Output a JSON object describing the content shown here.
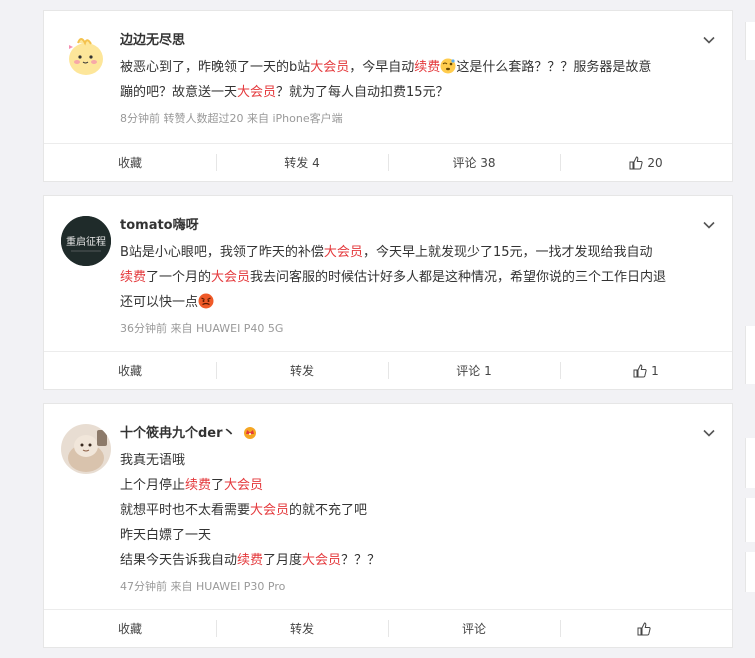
{
  "posts": [
    {
      "username": "边边无尽思",
      "lines": [
        [
          {
            "t": "被恶心到了，昨晚领了一天的b站"
          },
          {
            "t": "大会员",
            "hl": true
          },
          {
            "t": "，今早自动"
          },
          {
            "t": "续费",
            "hl": true
          },
          {
            "emoji": "dizzy-face"
          },
          {
            "t": "这是什么套路？？？服务器是故意"
          }
        ],
        [
          {
            "t": "蹦的吧？故意送一天"
          },
          {
            "t": "大会员",
            "hl": true
          },
          {
            "t": "？就为了每人自动扣费15元？"
          }
        ]
      ],
      "meta": "8分钟前  转赞人数超过20  来自 iPhone客户端",
      "actions": [
        "收藏",
        "转发 4",
        "评论 38",
        "20"
      ]
    },
    {
      "username": "tomato嗨呀",
      "lines": [
        [
          {
            "t": "B站是小心眼吧，我领了昨天的补偿"
          },
          {
            "t": "大会员",
            "hl": true
          },
          {
            "t": "，今天早上就发现少了15元，一找才发现给我自动"
          }
        ],
        [
          {
            "t": "续费",
            "hl": true
          },
          {
            "t": "了一个月的"
          },
          {
            "t": "大会员",
            "hl": true
          },
          {
            "t": "我去问客服的时候估计好多人都是这种情况，希望你说的三个工作日内退"
          }
        ],
        [
          {
            "t": "还可以快一点"
          },
          {
            "emoji": "angry-face"
          }
        ]
      ],
      "meta": "36分钟前  来自 HUAWEI P40 5G",
      "actions": [
        "收藏",
        "转发",
        "评论 1",
        "1"
      ],
      "avatar_text": "重启征程"
    },
    {
      "username": "十个筱冉九个der丶",
      "lines": [
        [
          {
            "t": "我真无语哦"
          }
        ],
        [
          {
            "t": "上个月停止"
          },
          {
            "t": "续费",
            "hl": true
          },
          {
            "t": "了"
          },
          {
            "t": "大会员",
            "hl": true
          }
        ],
        [
          {
            "t": "就想平时也不太看需要"
          },
          {
            "t": "大会员",
            "hl": true
          },
          {
            "t": "的就不充了吧"
          }
        ],
        [
          {
            "t": "昨天白嫖了一天"
          }
        ],
        [
          {
            "t": "结果今天告诉我自动"
          },
          {
            "t": "续费",
            "hl": true
          },
          {
            "t": "了月度"
          },
          {
            "t": "大会员",
            "hl": true
          },
          {
            "t": "？？？"
          }
        ]
      ],
      "meta": "47分钟前  来自 HUAWEI P30 Pro",
      "actions": [
        "收藏",
        "转发",
        "评论",
        ""
      ]
    }
  ],
  "colors": {
    "highlight": "#e4393c",
    "meta": "#999999",
    "text": "#333333"
  },
  "icons": {
    "expand": "chevron-down-icon",
    "like": "thumbs-up-icon",
    "vip": "crown-badge-icon"
  }
}
